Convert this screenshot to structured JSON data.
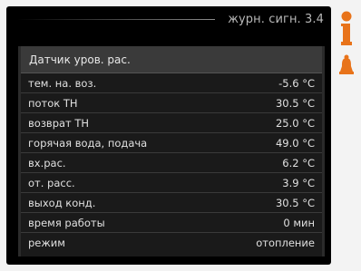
{
  "header": {
    "title": "журн. сигн. 3.4"
  },
  "panel": {
    "title": "Датчик уров. рас.",
    "rows": [
      {
        "label": "тем. на. воз.",
        "value": "-5.6  °C"
      },
      {
        "label": "поток ТН",
        "value": "30.5  °C"
      },
      {
        "label": "возврат ТН",
        "value": "25.0  °C"
      },
      {
        "label": "горячая вода, подача",
        "value": "49.0  °C"
      },
      {
        "label": "вх.рас.",
        "value": "6.2 °C"
      },
      {
        "label": "от. расс.",
        "value": "3.9 °C"
      },
      {
        "label": "выход конд.",
        "value": "30.5 °C"
      },
      {
        "label": "время работы",
        "value": "0 мин"
      },
      {
        "label": "режим",
        "value": "отопление"
      }
    ]
  },
  "icons": {
    "info": "info-icon",
    "alarm": "alarm-bell-icon"
  },
  "colors": {
    "accent": "#e8731a",
    "background": "#000000"
  }
}
